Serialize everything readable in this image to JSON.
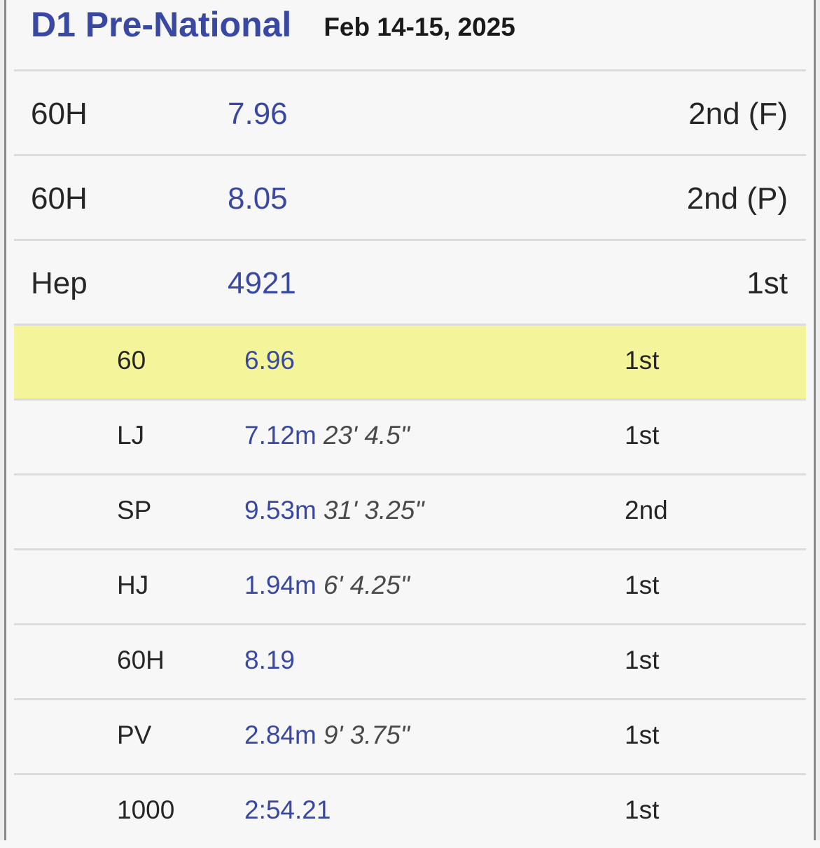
{
  "meet": {
    "name": "D1 Pre-National",
    "date": "Feb 14-15, 2025"
  },
  "results": [
    {
      "event": "60H",
      "mark": "7.96",
      "place": "2nd (F)"
    },
    {
      "event": "60H",
      "mark": "8.05",
      "place": "2nd (P)"
    },
    {
      "event": "Hep",
      "mark": "4921",
      "place": "1st"
    }
  ],
  "heptathlon_events": [
    {
      "event": "60",
      "mark": "6.96",
      "imperial": "",
      "place": "1st",
      "highlighted": true
    },
    {
      "event": "LJ",
      "mark": "7.12m",
      "imperial": "23' 4.5\"",
      "place": "1st"
    },
    {
      "event": "SP",
      "mark": "9.53m",
      "imperial": "31' 3.25\"",
      "place": "2nd"
    },
    {
      "event": "HJ",
      "mark": "1.94m",
      "imperial": "6' 4.25\"",
      "place": "1st"
    },
    {
      "event": "60H",
      "mark": "8.19",
      "imperial": "",
      "place": "1st"
    },
    {
      "event": "PV",
      "mark": "2.84m",
      "imperial": "9' 3.75\"",
      "place": "1st"
    },
    {
      "event": "1000",
      "mark": "2:54.21",
      "imperial": "",
      "place": "1st"
    }
  ],
  "colors": {
    "accent": "#3949a3",
    "highlight": "#f4f59a"
  }
}
